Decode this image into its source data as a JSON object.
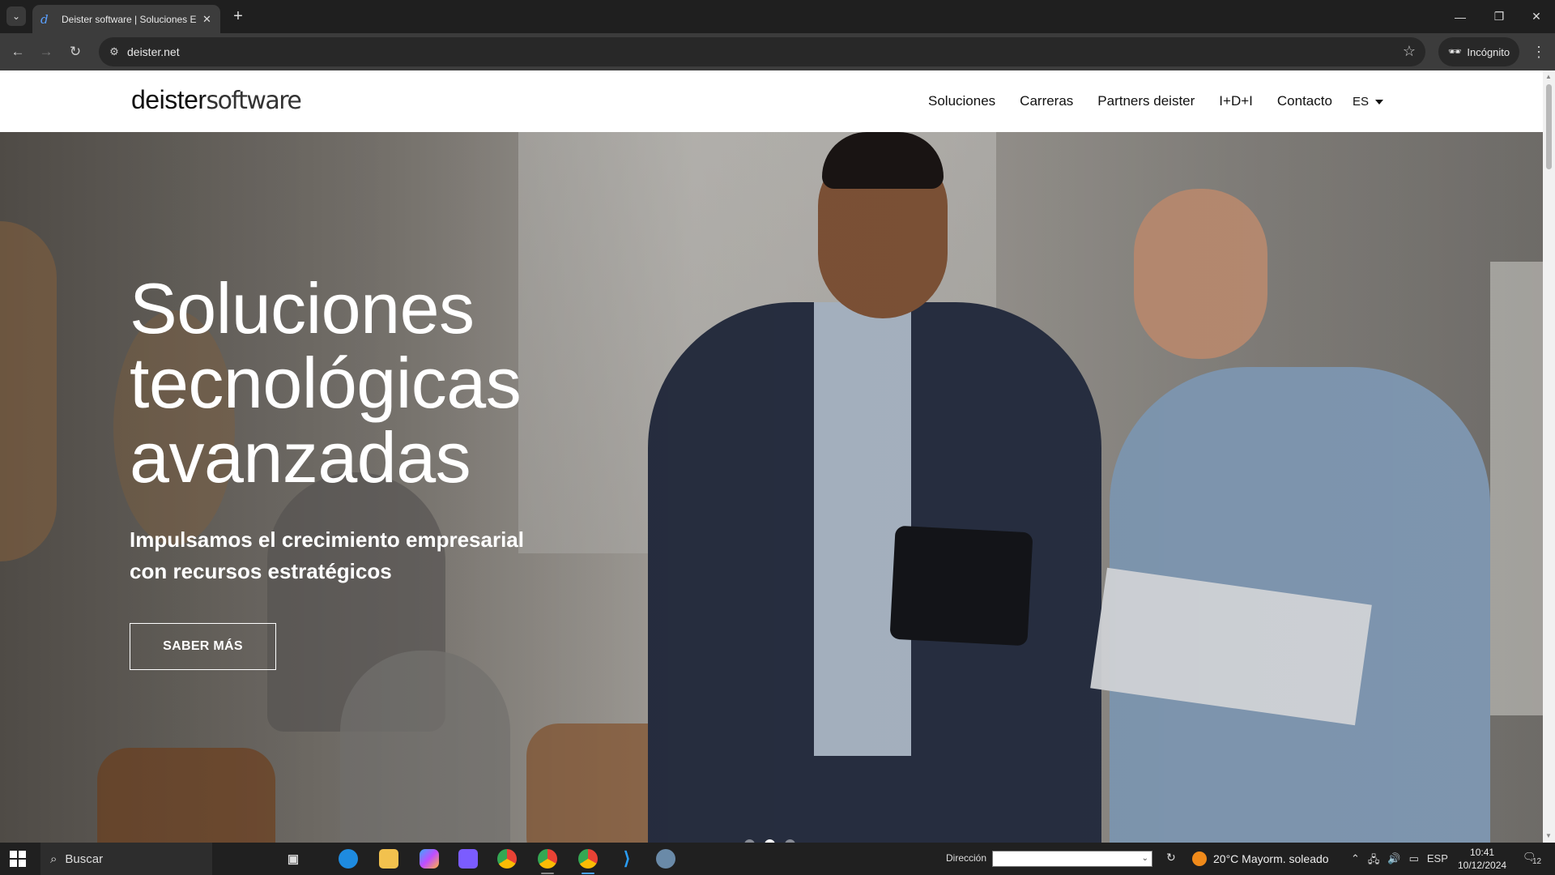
{
  "browser": {
    "tab_title": "Deister software | Soluciones El",
    "url": "deister.net",
    "incognito_label": "Incógnito",
    "icons": [
      "tab-list-icon",
      "favicon-icon",
      "close-icon",
      "plus-icon",
      "minimize-icon",
      "restore-icon",
      "close-window-icon",
      "back-icon",
      "forward-icon",
      "reload-icon",
      "site-info-icon",
      "star-icon",
      "incognito-icon",
      "kebab-menu-icon"
    ]
  },
  "site": {
    "logo_bold": "deister",
    "logo_light": "software",
    "nav": [
      "Soluciones",
      "Carreras",
      "Partners deister",
      "I+D+I",
      "Contacto"
    ],
    "lang": "ES"
  },
  "hero": {
    "title": "Soluciones tecnológicas avanzadas",
    "subtitle": "Impulsamos el crecimiento empresarial con recursos estratégicos",
    "button": "SABER MÁS",
    "slides": 3,
    "active_slide": 2
  },
  "taskbar": {
    "search_placeholder": "Buscar",
    "direccion_label": "Dirección",
    "weather": "20°C  Mayorm. soleado",
    "lang": "ESP",
    "time": "10:41",
    "date": "10/12/2024",
    "notifications": "12",
    "colors": {
      "accent": "#0078d4",
      "brand_blue": "#5aa0ff"
    }
  }
}
